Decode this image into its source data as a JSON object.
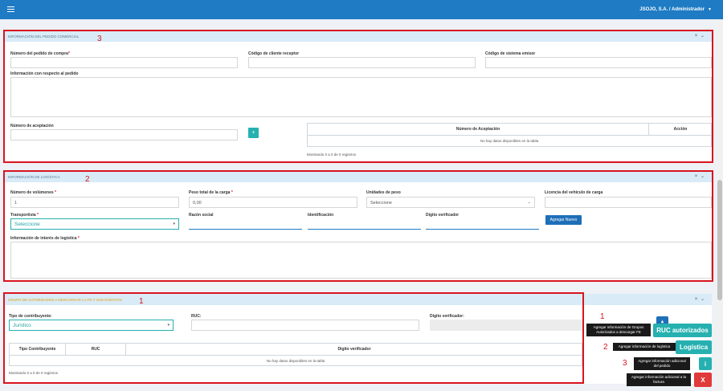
{
  "topbar": {
    "user": "JSOJO, S.A. / Administrador"
  },
  "colors": {
    "primary": "#1e7bc4",
    "teal": "#26b0b0",
    "red": "#e03a3a",
    "annotation": "#d9141e"
  },
  "icons": [
    "menu-icon",
    "caret-down-icon",
    "close-icon",
    "collapse-icon",
    "plus-icon"
  ],
  "annotations": {
    "commercial": "3",
    "logistics": "2",
    "authorized": "1",
    "fab_1": "1",
    "fab_2": "2",
    "fab_3": "3"
  },
  "commercial": {
    "header": "INFORMACIÓN DEL PEDIDO COMERCIAL",
    "controls": "× ⌄",
    "purchase_order_label": "Número del pedido de compra",
    "receiver_code_label": "Código de cliente receptor",
    "issuer_code_label": "Código de sistema emisor",
    "order_info_label": "Información con respecto al pedido",
    "acceptance_label": "Número de aceptación",
    "add_symbol": "+",
    "table_headers": [
      "Número de Aceptación",
      "Acción"
    ],
    "empty_text": "No hay datos disponibles en la tabla",
    "showing": "Mostrando 0 a 0 de 0 registros"
  },
  "logistics": {
    "header": "INFORMACIÓN DE LOGÍSTICA",
    "controls": "× ⌄",
    "volumes_label": "Número de volúmenes",
    "volumes_value": "1",
    "weight_label": "Peso total de la carga",
    "weight_value": "0,00",
    "unit_label": "Unidades de peso",
    "unit_value": "Seleccione",
    "license_label": "Licencia del vehículo de carga",
    "carrier_label": "Transportista",
    "carrier_value": "Seleccione",
    "company_label": "Razón social",
    "id_label": "Identificación",
    "check_digit_label": "Digito verificador",
    "add_new_button": "Agregar Nuevo",
    "interest_label": "Información de interés de logística"
  },
  "authorized": {
    "header": "GRUPO DE AUTORIZADOS A DESCARGAR LA FE Y SUS EVENTOS",
    "controls": "× ⌄",
    "taxpayer_label": "Tipo de contribuyente:",
    "taxpayer_value": "Jurídico",
    "ruc_label": "RUC:",
    "check_digit_label": "Digito verificador:",
    "table_headers": [
      "Tipo Contribuyente",
      "RUC",
      "Digito verificador"
    ],
    "empty_text": "No hay datos disponibles en la tabla",
    "showing": "Mostrando 0 a 0 de 0 registros"
  },
  "fabs": {
    "ruc_tip": "Agregar información de Grupos Autorizados a descargar FE",
    "ruc_button": "RUC autorizados",
    "logistics_tip": "Agregar información de logística",
    "logistics_button": "Logística",
    "extra_tip": "Agregar información adicional del pedido",
    "extra_button": "i",
    "invoice_tip": "Agregar información adicional a la factura",
    "invoice_button": "X"
  }
}
